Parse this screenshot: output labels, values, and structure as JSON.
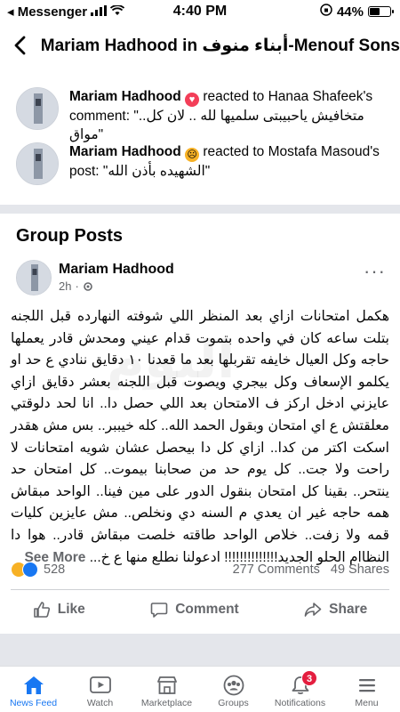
{
  "status": {
    "carrier": "◂ Messenger",
    "time": "4:40 PM",
    "battery_text": "44%",
    "battery_level": 0.44
  },
  "header": {
    "title": "Mariam Hadhood in أبناء منوف-Menouf Sons"
  },
  "activity": [
    {
      "name": "Mariam Hadhood",
      "reaction": "love",
      "action": "reacted to Hanaa Shafeek's",
      "rest": "comment: \"..متخافيش ياحبيبتى سلميها لله .. لان كل مواق\""
    },
    {
      "name": "Mariam Hadhood",
      "reaction": "sad",
      "action": "reacted to Mostafa",
      "rest": "Masoud's post: \"الشهيده بأذن الله\""
    }
  ],
  "section_title": "Group Posts",
  "post": {
    "author": "Mariam Hadhood",
    "time": "2h",
    "more": "···",
    "body": "هكمل امتحانات ازاي بعد المنظر اللي شوفته النهارده قبل اللجنه بتلت ساعه كان في واحده بتموت قدام عيني ومحدش قادر يعملها حاجه وكل العيال خايفه تقربلها بعد ما قعدنا ١٠ دقايق ننادي ع حد او يكلمو الإسعاف وكل بيجري ويصوت قبل اللجنه بعشر دقايق ازاي عايزني ادخل اركز ف الامتحان بعد اللي حصل دا.. انا لحد دلوقتي معلقتش ع اي امتحان وبقول الحمد الله.. كله خيببر.. بس مش هقدر اسكت اكتر من كدا.. ازاي كل دا بيحصل عشان شويه امتحانات لا راحت ولا جت.. كل يوم حد من صحابنا بيموت.. كل امتحان حد ينتحر.. بقينا كل امتحان بنقول الدور على مين فينا.. الواحد مبقاش همه حاجه غير ان يعدي م السنه دي ونخلص.. مش عايزين كليات قمه ولا زفت.. خلاص الواحد طاقته خلصت مبقاش قادر.. هوا دا النظاام الحلو الجديد!!!!!!!!!!!!!! ادعولنا نطلع منها ع خ...",
    "see_more": "See More",
    "reactions_count": "528",
    "comments": "277 Comments",
    "shares": "49 Shares",
    "watermark": "اليوم"
  },
  "actions": {
    "like": "Like",
    "comment": "Comment",
    "share": "Share"
  },
  "tabs": [
    {
      "label": "News Feed",
      "icon": "home-icon",
      "active": true
    },
    {
      "label": "Watch",
      "icon": "watch-icon"
    },
    {
      "label": "Marketplace",
      "icon": "marketplace-icon"
    },
    {
      "label": "Groups",
      "icon": "groups-icon"
    },
    {
      "label": "Notifications",
      "icon": "bell-icon",
      "badge": "3"
    },
    {
      "label": "Menu",
      "icon": "menu-icon"
    }
  ],
  "colors": {
    "accent": "#1877f2",
    "love": "#f33e58",
    "sad": "#f7b125",
    "badge": "#e41e3f"
  }
}
